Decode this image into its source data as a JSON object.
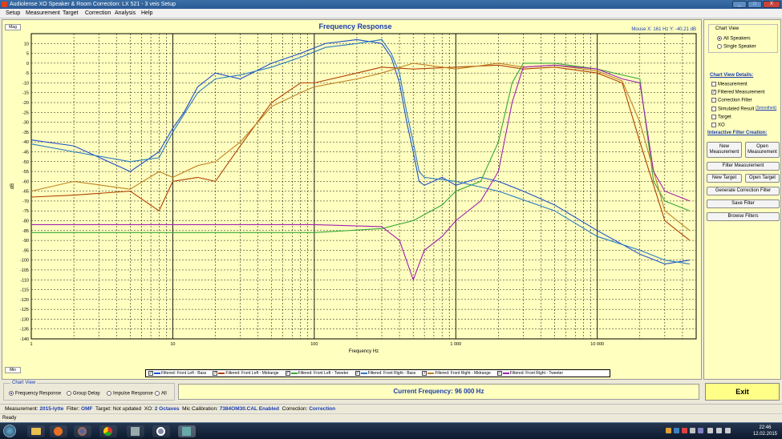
{
  "window": {
    "title": "Audiolense XO Speaker & Room Correction: LX 521 - 3 veis Setup",
    "min": "_",
    "max": "□",
    "close": "X"
  },
  "menu": [
    "Setup",
    "Measurement",
    "Target",
    "Correction",
    "Analysis",
    "Help"
  ],
  "side_tabs": {
    "top": "Mag",
    "bottom": "Min"
  },
  "chart_data": {
    "type": "line",
    "title": "Frequency Response",
    "xlabel": "Frequency Hz",
    "ylabel": "dB",
    "xscale": "log",
    "xlim": [
      1,
      50000
    ],
    "ylim": [
      -140,
      15
    ],
    "xticks": [
      {
        "v": 1,
        "l": "1"
      },
      {
        "v": 10,
        "l": "10"
      },
      {
        "v": 100,
        "l": "100"
      },
      {
        "v": 1000,
        "l": "1 000"
      },
      {
        "v": 10000,
        "l": "10 000"
      }
    ],
    "yticks": [
      10,
      5,
      0,
      -5,
      -10,
      -15,
      -20,
      -25,
      -30,
      -35,
      -40,
      -45,
      -50,
      -55,
      -60,
      -65,
      -70,
      -75,
      -80,
      -85,
      -90,
      -95,
      -100,
      -105,
      -110,
      -115,
      -120,
      -125,
      -130,
      -135,
      -140
    ],
    "grid": true,
    "legend_position": "bottom",
    "series": [
      {
        "name": "Filtered: Front Left - Bass",
        "color": "#1f4fc8",
        "points": [
          [
            1,
            -39
          ],
          [
            2,
            -42
          ],
          [
            5,
            -55
          ],
          [
            8,
            -45
          ],
          [
            10,
            -33
          ],
          [
            12,
            -25
          ],
          [
            15,
            -12
          ],
          [
            20,
            -5
          ],
          [
            30,
            -8
          ],
          [
            50,
            0
          ],
          [
            80,
            5
          ],
          [
            120,
            10
          ],
          [
            200,
            12
          ],
          [
            300,
            10
          ],
          [
            350,
            3
          ],
          [
            400,
            -10
          ],
          [
            450,
            -30
          ],
          [
            500,
            -45
          ],
          [
            550,
            -60
          ],
          [
            600,
            -62
          ],
          [
            800,
            -58
          ],
          [
            1000,
            -62
          ],
          [
            1500,
            -58
          ],
          [
            2000,
            -60
          ],
          [
            3000,
            -65
          ],
          [
            5000,
            -72
          ],
          [
            10000,
            -85
          ],
          [
            20000,
            -97
          ],
          [
            30000,
            -102
          ],
          [
            45000,
            -100
          ]
        ]
      },
      {
        "name": "Filtered: Front Left - Midrange",
        "color": "#b04000",
        "points": [
          [
            1,
            -68
          ],
          [
            2,
            -67
          ],
          [
            5,
            -65
          ],
          [
            8,
            -75
          ],
          [
            10,
            -60
          ],
          [
            15,
            -58
          ],
          [
            20,
            -60
          ],
          [
            30,
            -42
          ],
          [
            50,
            -20
          ],
          [
            80,
            -10
          ],
          [
            100,
            -10
          ],
          [
            200,
            -5
          ],
          [
            300,
            -2
          ],
          [
            500,
            -3
          ],
          [
            1000,
            -2
          ],
          [
            2000,
            -1
          ],
          [
            3000,
            -3
          ],
          [
            5000,
            -2
          ],
          [
            10000,
            -5
          ],
          [
            15000,
            -10
          ],
          [
            20000,
            -40
          ],
          [
            30000,
            -80
          ],
          [
            45000,
            -90
          ]
        ]
      },
      {
        "name": "Filtered: Front Left - Tweeter",
        "color": "#38a838",
        "points": [
          [
            1,
            -86
          ],
          [
            10,
            -86
          ],
          [
            100,
            -86
          ],
          [
            300,
            -84
          ],
          [
            500,
            -80
          ],
          [
            800,
            -72
          ],
          [
            1000,
            -65
          ],
          [
            1500,
            -60
          ],
          [
            2000,
            -40
          ],
          [
            2500,
            -10
          ],
          [
            3000,
            0
          ],
          [
            5000,
            0
          ],
          [
            10000,
            -3
          ],
          [
            15000,
            -6
          ],
          [
            20000,
            -8
          ],
          [
            25000,
            -60
          ],
          [
            30000,
            -70
          ],
          [
            45000,
            -75
          ]
        ]
      },
      {
        "name": "Filtered: Front Right - Bass",
        "color": "#2a7ac0",
        "points": [
          [
            1,
            -41
          ],
          [
            2,
            -45
          ],
          [
            5,
            -50
          ],
          [
            8,
            -48
          ],
          [
            10,
            -35
          ],
          [
            15,
            -15
          ],
          [
            20,
            -8
          ],
          [
            30,
            -6
          ],
          [
            50,
            -2
          ],
          [
            80,
            3
          ],
          [
            120,
            8
          ],
          [
            200,
            10
          ],
          [
            300,
            12
          ],
          [
            350,
            5
          ],
          [
            400,
            -5
          ],
          [
            450,
            -25
          ],
          [
            500,
            -40
          ],
          [
            550,
            -55
          ],
          [
            600,
            -58
          ],
          [
            1000,
            -60
          ],
          [
            2000,
            -65
          ],
          [
            5000,
            -75
          ],
          [
            10000,
            -88
          ],
          [
            20000,
            -95
          ],
          [
            30000,
            -100
          ],
          [
            45000,
            -102
          ]
        ]
      },
      {
        "name": "Filtered: Front Right - Midrange",
        "color": "#c08020",
        "points": [
          [
            1,
            -65
          ],
          [
            2,
            -60
          ],
          [
            5,
            -64
          ],
          [
            8,
            -55
          ],
          [
            10,
            -58
          ],
          [
            15,
            -52
          ],
          [
            20,
            -50
          ],
          [
            30,
            -40
          ],
          [
            50,
            -22
          ],
          [
            80,
            -15
          ],
          [
            100,
            -12
          ],
          [
            200,
            -8
          ],
          [
            300,
            -5
          ],
          [
            500,
            0
          ],
          [
            1000,
            -3
          ],
          [
            2000,
            0
          ],
          [
            3000,
            -2
          ],
          [
            5000,
            -1
          ],
          [
            10000,
            -4
          ],
          [
            15000,
            -9
          ],
          [
            20000,
            -30
          ],
          [
            30000,
            -75
          ],
          [
            45000,
            -85
          ]
        ]
      },
      {
        "name": "Filtered: Front Right - Tweeter",
        "color": "#a020b0",
        "points": [
          [
            1,
            -82
          ],
          [
            10,
            -82
          ],
          [
            100,
            -82
          ],
          [
            300,
            -83
          ],
          [
            400,
            -90
          ],
          [
            500,
            -110
          ],
          [
            600,
            -95
          ],
          [
            800,
            -88
          ],
          [
            1000,
            -80
          ],
          [
            1500,
            -70
          ],
          [
            2000,
            -55
          ],
          [
            2500,
            -20
          ],
          [
            3000,
            -2
          ],
          [
            5000,
            -1
          ],
          [
            10000,
            -3
          ],
          [
            15000,
            -8
          ],
          [
            20000,
            -10
          ],
          [
            25000,
            -55
          ],
          [
            30000,
            -65
          ],
          [
            45000,
            -70
          ]
        ]
      }
    ]
  },
  "mouse_readout": "Mouse X: 161 Hz   Y: -40,21 dB",
  "right_panel": {
    "chart_view_title": "Chart View",
    "radio_all": "All Speakers",
    "radio_single": "Single Speaker",
    "details_title": "Chart View Details:",
    "checks": [
      {
        "label": "Measurement",
        "checked": false
      },
      {
        "label": "Filtered Measurement",
        "checked": true
      },
      {
        "label": "Correction Filter",
        "checked": false
      },
      {
        "label": "Simulated Result",
        "checked": false
      },
      {
        "label": "Target",
        "checked": false
      },
      {
        "label": "XO",
        "checked": false
      }
    ],
    "smoothed": "(Smoothed)",
    "interactive_title": "Interactive Filter Creation:",
    "btn_new_meas": "New Measurement",
    "btn_open_meas": "Open Measurement",
    "btn_filter_meas": "Filter Measurement",
    "btn_new_target": "New Target",
    "btn_open_target": "Open Target",
    "btn_gen": "Generate Correction Filter",
    "btn_save": "Save Filter",
    "btn_browse": "Browse Filters"
  },
  "bottom": {
    "legend_title": "Chart View",
    "opt1": "Frequency Response",
    "opt2": "Group Delay",
    "opt3": "Impulse Response",
    "opt4": "All",
    "current_freq": "Current Frequency: 96 000 Hz",
    "exit": "Exit"
  },
  "info": {
    "l1": "Measurement:",
    "v1": "2015-lytte",
    "l2": "Filter:",
    "v2": "OMF",
    "l3": "Target:",
    "v3": "Not updated",
    "l4": "XO:",
    "v4": "2 Octaves",
    "l5": "Mic Calibration:",
    "v5": "7384OM30.CAL Enabled",
    "l6": "Correction:",
    "v6": "Correction"
  },
  "status": "Ready",
  "clock": {
    "time": "22:46",
    "date": "12.02.2015"
  }
}
